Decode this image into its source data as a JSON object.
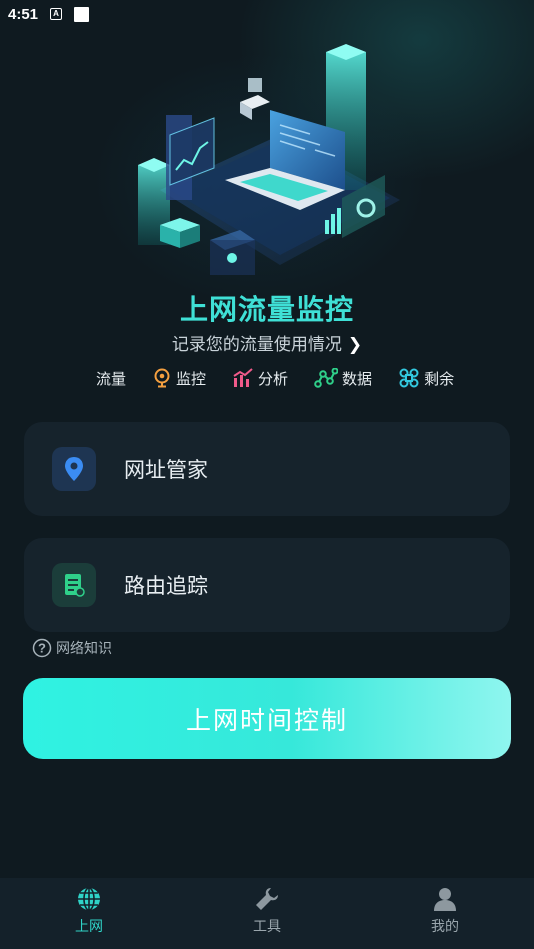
{
  "status_bar": {
    "time": "4:51",
    "indicator": "A"
  },
  "hero": {
    "title": "上网流量监控",
    "subtitle": "记录您的流量使用情况",
    "features": [
      {
        "label": "流量",
        "icon": "none"
      },
      {
        "label": "监控",
        "icon": "location-pin-icon"
      },
      {
        "label": "分析",
        "icon": "chart-icon"
      },
      {
        "label": "数据",
        "icon": "nodes-icon"
      },
      {
        "label": "剩余",
        "icon": "command-icon"
      }
    ]
  },
  "cards": [
    {
      "label": "网址管家",
      "icon": "location-pin-icon"
    },
    {
      "label": "路由追踪",
      "icon": "document-icon"
    }
  ],
  "knowledge": {
    "label": "网络知识"
  },
  "main_button": {
    "label": "上网时间控制"
  },
  "bottom_nav": [
    {
      "label": "上网",
      "icon": "globe-icon",
      "active": true
    },
    {
      "label": "工具",
      "icon": "wrench-icon",
      "active": false
    },
    {
      "label": "我的",
      "icon": "person-icon",
      "active": false
    }
  ],
  "colors": {
    "background": "#0f1a20",
    "accent": "#2fd3c7",
    "title": "#3fe0d6",
    "card": "#16232c",
    "button_start": "#2ff2e2",
    "button_end": "#8ff6ef"
  }
}
